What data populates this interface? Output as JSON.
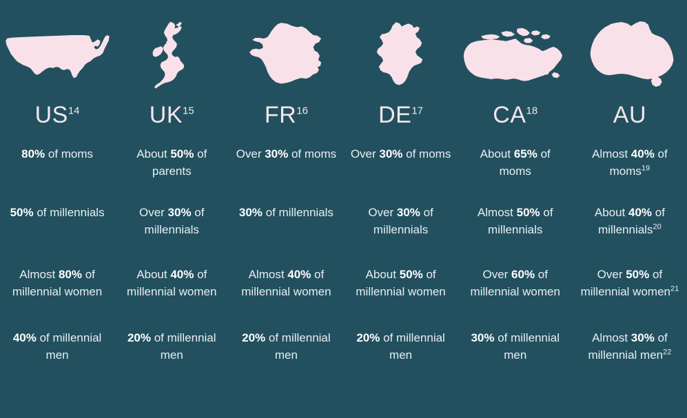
{
  "theme": {
    "background": "#22505f",
    "map_fill": "#f9e1e9",
    "text_color": "#e8eff1",
    "bold_color": "#ffffff"
  },
  "columns": [
    {
      "code": "US",
      "footnote": "14",
      "map_icon": "united-states-map-icon"
    },
    {
      "code": "UK",
      "footnote": "15",
      "map_icon": "united-kingdom-map-icon"
    },
    {
      "code": "FR",
      "footnote": "16",
      "map_icon": "france-map-icon"
    },
    {
      "code": "DE",
      "footnote": "17",
      "map_icon": "germany-map-icon"
    },
    {
      "code": "CA",
      "footnote": "18",
      "map_icon": "canada-map-icon"
    },
    {
      "code": "AU",
      "footnote": "",
      "map_icon": "australia-map-icon"
    }
  ],
  "rows": [
    {
      "group": "moms",
      "cells": [
        {
          "prefix": "",
          "value": "80%",
          "suffix": " of moms",
          "footnote": ""
        },
        {
          "prefix": "About ",
          "value": "50%",
          "suffix": " of parents",
          "footnote": ""
        },
        {
          "prefix": "Over ",
          "value": "30%",
          "suffix": " of moms",
          "footnote": ""
        },
        {
          "prefix": "Over ",
          "value": "30%",
          "suffix": " of moms",
          "footnote": ""
        },
        {
          "prefix": "About ",
          "value": "65%",
          "suffix": " of moms",
          "footnote": ""
        },
        {
          "prefix": "Almost ",
          "value": "40%",
          "suffix": " of moms",
          "footnote": "19"
        }
      ]
    },
    {
      "group": "millennials",
      "cells": [
        {
          "prefix": "",
          "value": "50%",
          "suffix": " of millennials",
          "footnote": ""
        },
        {
          "prefix": "Over ",
          "value": "30%",
          "suffix": " of millennials",
          "footnote": ""
        },
        {
          "prefix": "",
          "value": "30%",
          "suffix": " of millennials",
          "footnote": ""
        },
        {
          "prefix": "Over ",
          "value": "30%",
          "suffix": " of millennials",
          "footnote": ""
        },
        {
          "prefix": "Almost ",
          "value": "50%",
          "suffix": " of millennials",
          "footnote": ""
        },
        {
          "prefix": "About ",
          "value": "40%",
          "suffix": " of millennials",
          "footnote": "20"
        }
      ]
    },
    {
      "group": "millennial-women",
      "cells": [
        {
          "prefix": "Almost ",
          "value": "80%",
          "suffix": " of millennial women",
          "footnote": ""
        },
        {
          "prefix": "About ",
          "value": "40%",
          "suffix": " of millennial women",
          "footnote": ""
        },
        {
          "prefix": "Almost ",
          "value": "40%",
          "suffix": " of millennial women",
          "footnote": ""
        },
        {
          "prefix": "About ",
          "value": "50%",
          "suffix": " of millennial women",
          "footnote": ""
        },
        {
          "prefix": "Over ",
          "value": "60%",
          "suffix": " of millennial women",
          "footnote": ""
        },
        {
          "prefix": "Over ",
          "value": "50%",
          "suffix": " of millennial women",
          "footnote": "21"
        }
      ]
    },
    {
      "group": "millennial-men",
      "cells": [
        {
          "prefix": "",
          "value": "40%",
          "suffix": " of millennial men",
          "footnote": ""
        },
        {
          "prefix": "",
          "value": "20%",
          "suffix": " of millennial men",
          "footnote": ""
        },
        {
          "prefix": "",
          "value": "20%",
          "suffix": " of millennial men",
          "footnote": ""
        },
        {
          "prefix": "",
          "value": "20%",
          "suffix": " of millennial men",
          "footnote": ""
        },
        {
          "prefix": "",
          "value": "30%",
          "suffix": " of millennial men",
          "footnote": ""
        },
        {
          "prefix": "Almost ",
          "value": "30%",
          "suffix": " of millennial men",
          "footnote": "22"
        }
      ]
    }
  ]
}
